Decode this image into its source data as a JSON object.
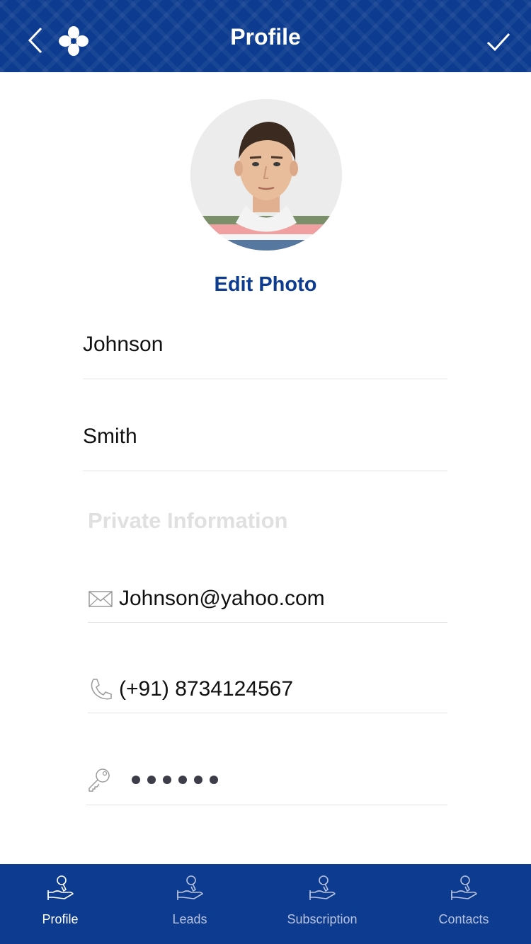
{
  "header": {
    "title": "Profile",
    "back_icon": "chevron-left-icon",
    "logo_icon": "clover-logo-icon",
    "confirm_icon": "checkmark-icon",
    "background_color": "#0d3b8f"
  },
  "profile": {
    "edit_photo_label": "Edit Photo",
    "first_name": "Johnson",
    "last_name": "Smith"
  },
  "private": {
    "section_label": "Private Information",
    "email": "Johnson@yahoo.com",
    "email_icon": "envelope-icon",
    "phone": "(+91) 8734124567",
    "phone_icon": "phone-icon",
    "password_icon": "key-icon"
  },
  "tabbar": {
    "items": [
      {
        "label": "Profile",
        "icon": "hand-key-icon",
        "active": true
      },
      {
        "label": "Leads",
        "icon": "hand-key-icon",
        "active": false
      },
      {
        "label": "Subscription",
        "icon": "hand-key-icon",
        "active": false
      },
      {
        "label": "Contacts",
        "icon": "hand-key-icon",
        "active": false
      }
    ]
  },
  "colors": {
    "brand": "#0d3b8f",
    "section_label": "#e0e0e0",
    "divider": "#e2e2e2",
    "inactive_tab_label": "#b7c3dc"
  }
}
